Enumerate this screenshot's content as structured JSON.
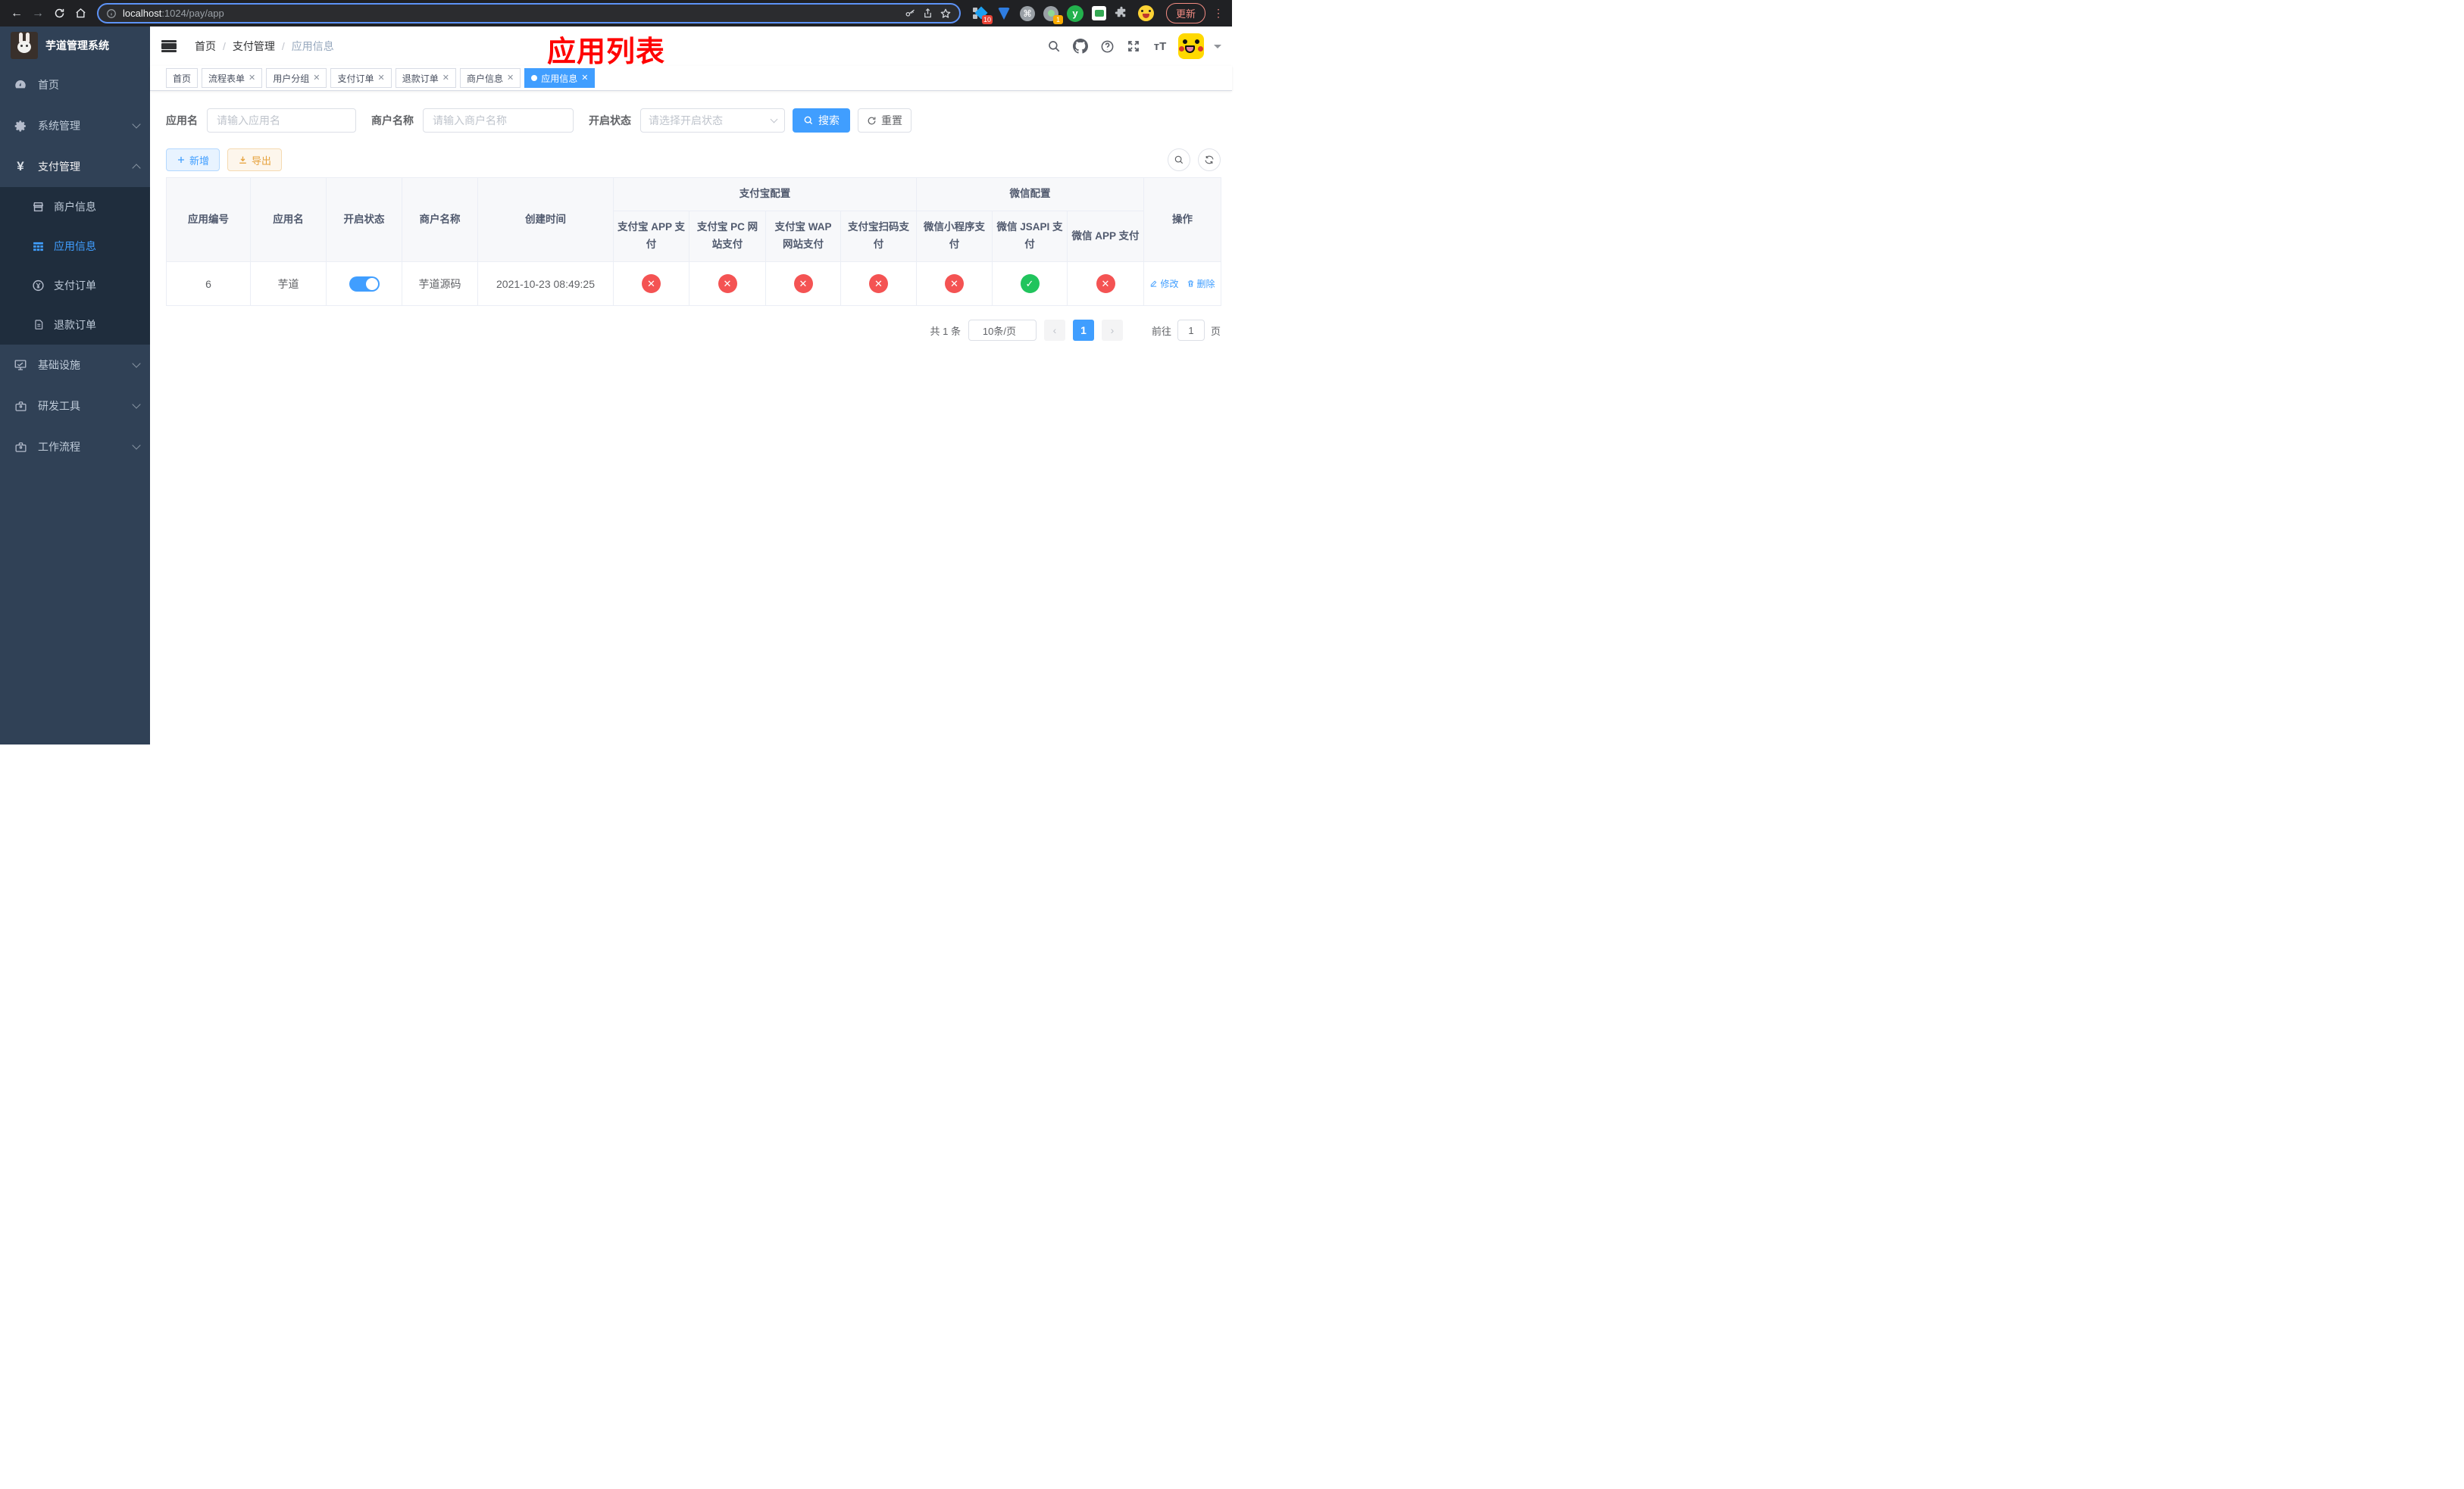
{
  "browser": {
    "url": {
      "host": "localhost",
      "rest": ":1024/pay/app"
    },
    "update_label": "更新",
    "ext_badge_10": "10",
    "ext_badge_1": "1",
    "ext_y_label": "y"
  },
  "sidebar": {
    "title": "芋道管理系统",
    "menu": [
      {
        "label": "首页"
      },
      {
        "label": "系统管理"
      },
      {
        "label": "支付管理"
      },
      {
        "label": "基础设施"
      },
      {
        "label": "研发工具"
      },
      {
        "label": "工作流程"
      }
    ],
    "submenu": [
      {
        "label": "商户信息"
      },
      {
        "label": "应用信息"
      },
      {
        "label": "支付订单"
      },
      {
        "label": "退款订单"
      }
    ]
  },
  "header": {
    "breadcrumb": [
      "首页",
      "支付管理",
      "应用信息"
    ],
    "annotation": "应用列表"
  },
  "tabs": [
    {
      "label": "首页"
    },
    {
      "label": "流程表单"
    },
    {
      "label": "用户分组"
    },
    {
      "label": "支付订单"
    },
    {
      "label": "退款订单"
    },
    {
      "label": "商户信息"
    },
    {
      "label": "应用信息"
    }
  ],
  "search": {
    "fields": [
      {
        "label": "应用名",
        "placeholder": "请输入应用名"
      },
      {
        "label": "商户名称",
        "placeholder": "请输入商户名称"
      },
      {
        "label": "开启状态",
        "placeholder": "请选择开启状态"
      }
    ],
    "search_label": "搜索",
    "reset_label": "重置"
  },
  "toolbar": {
    "add_label": "新增",
    "export_label": "导出"
  },
  "table": {
    "groups": {
      "alipay": "支付宝配置",
      "wechat": "微信配置"
    },
    "columns": {
      "id": "应用编号",
      "name": "应用名",
      "status": "开启状态",
      "merchant": "商户名称",
      "created": "创建时间",
      "alipay_app": "支付宝 APP 支付",
      "alipay_pc": "支付宝 PC 网站支付",
      "alipay_wap": "支付宝 WAP 网站支付",
      "alipay_qr": "支付宝扫码支付",
      "wx_mini": "微信小程序支付",
      "wx_jsapi": "微信 JSAPI 支付",
      "wx_app": "微信 APP 支付",
      "actions": "操作"
    },
    "row": {
      "id": "6",
      "name": "芋道",
      "enabled": "on",
      "merchant": "芋道源码",
      "created": "2021-10-23 08:49:25",
      "configs": [
        "off",
        "off",
        "off",
        "off",
        "off",
        "on",
        "off"
      ],
      "edit_label": "修改",
      "delete_label": "删除"
    }
  },
  "pagination": {
    "total": "共 1 条",
    "page_size": "10条/页",
    "page": "1",
    "goto_label": "前往",
    "goto_value": "1",
    "page_unit": "页"
  },
  "theme": {
    "accent": "#409eff",
    "success": "#21c45d",
    "danger": "#f45353",
    "annotation_color": "#ff0100"
  }
}
